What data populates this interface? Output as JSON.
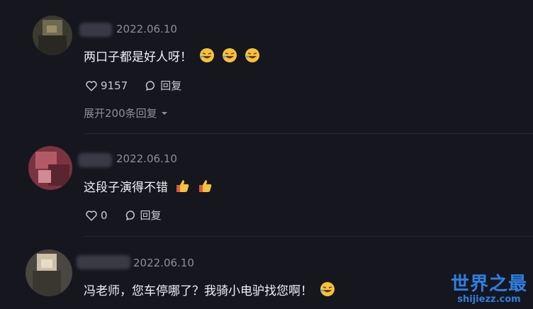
{
  "comments": [
    {
      "date": "2022.06.10",
      "text": "两口子都是好人呀！",
      "likes": "9157",
      "reply_label": "回复",
      "expand_label": "展开200条回复"
    },
    {
      "date": "2022.06.10",
      "text": "这段子演得不错",
      "likes": "0",
      "reply_label": "回复"
    },
    {
      "date": "2022.06.10",
      "text": "冯老师，您车停哪了？我骑小电驴找您啊！"
    }
  ],
  "watermark": {
    "title": "世界之最",
    "subtitle": "shijiezz.com"
  },
  "colors": {
    "background": "#16161e",
    "muted_text": "#8e8e99",
    "watermark": "#2e7fe3"
  },
  "icons": [
    "heart-icon",
    "comment-bubble-icon",
    "chevron-down-icon",
    "laughing-emoji-icon",
    "thumbs-up-emoji-icon"
  ]
}
